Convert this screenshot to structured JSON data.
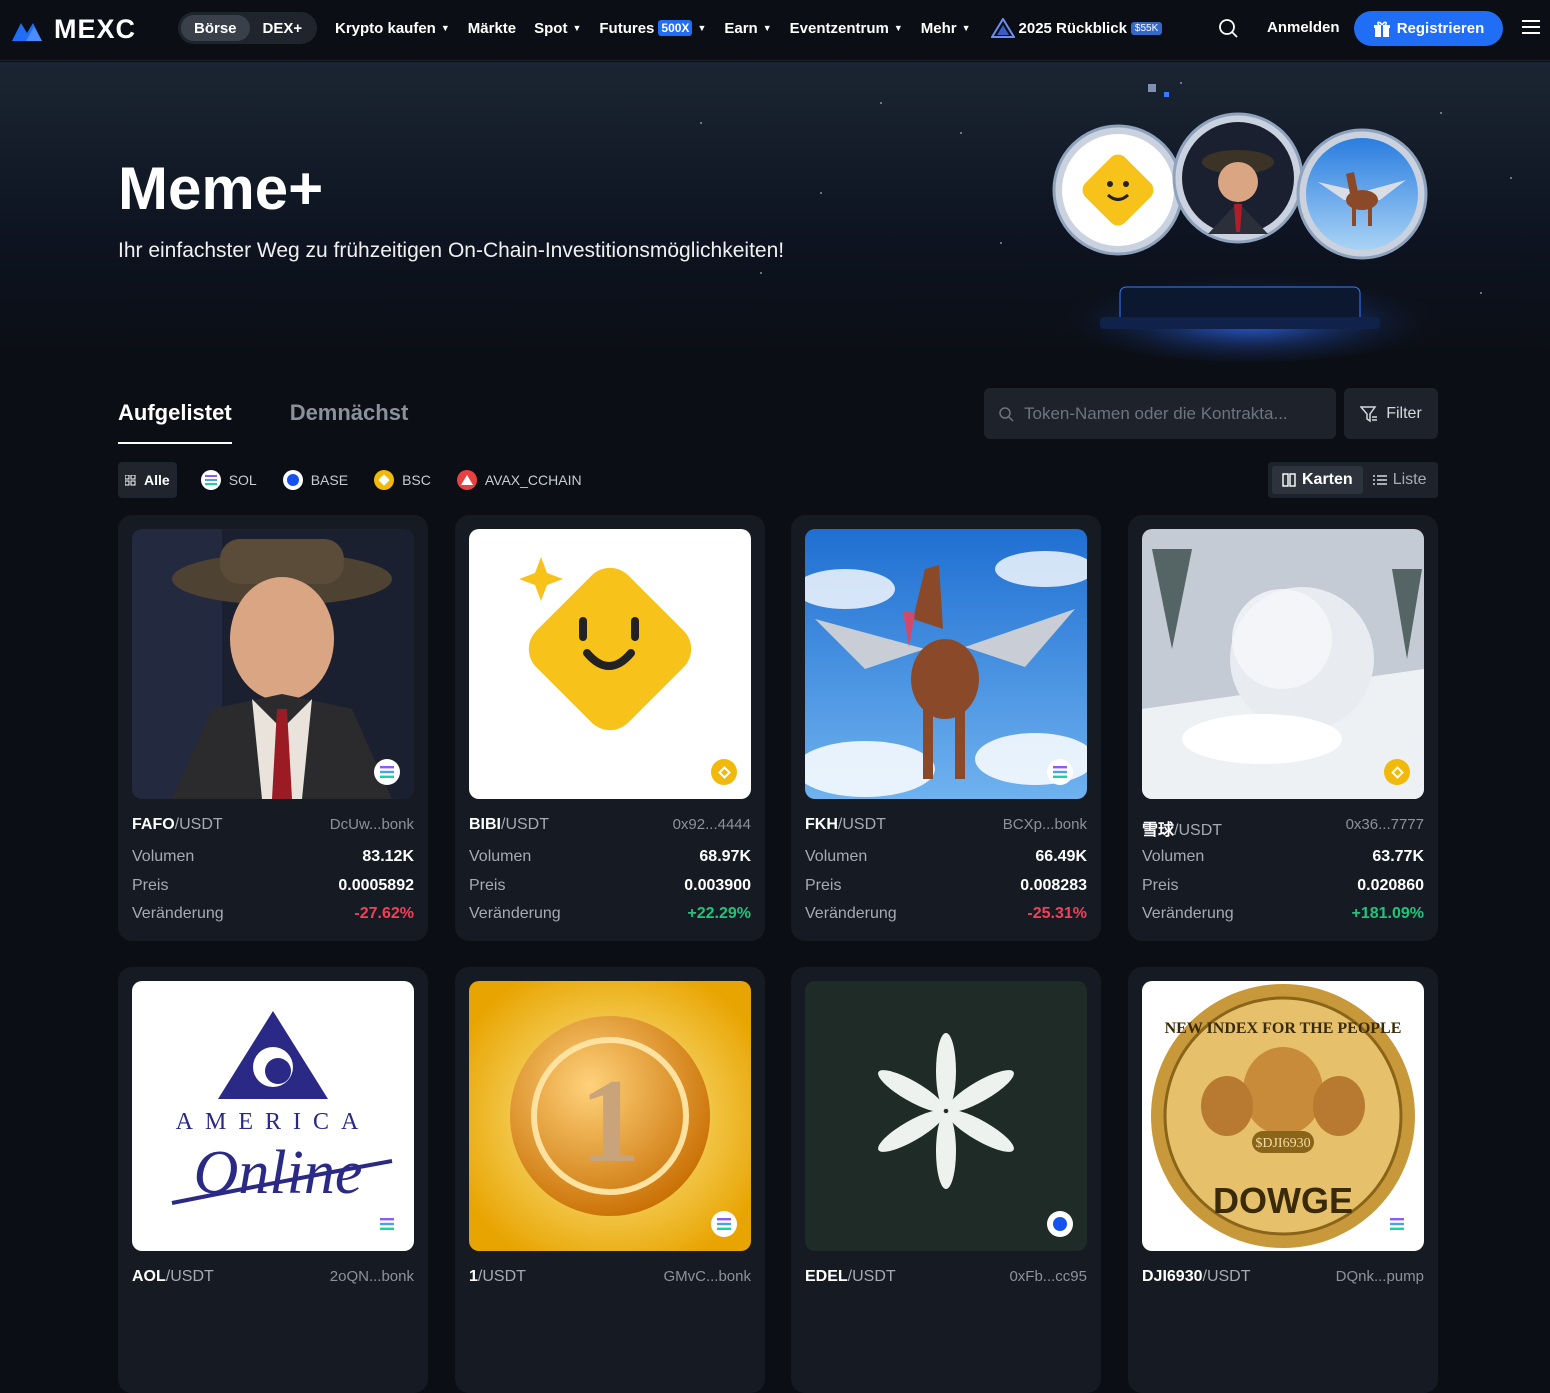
{
  "nav": {
    "brand": "MEXC",
    "segment": [
      "Börse",
      "DEX+"
    ],
    "links": [
      {
        "label": "Krypto kaufen",
        "caret": true
      },
      {
        "label": "Märkte",
        "caret": false
      },
      {
        "label": "Spot",
        "caret": true
      },
      {
        "label": "Futures",
        "badge": "500X",
        "caret": true
      },
      {
        "label": "Earn",
        "caret": true
      },
      {
        "label": "Eventzentrum",
        "caret": true
      },
      {
        "label": "Mehr",
        "caret": true
      },
      {
        "label": "2025 Rückblick",
        "badge": "$55K",
        "caret": false
      }
    ],
    "login": "Anmelden",
    "register": "Registrieren"
  },
  "hero": {
    "title": "Meme+",
    "subtitle": "Ihr einfachster Weg zu frühzeitigen On-Chain-Investitionsmöglichkeiten!"
  },
  "tabs": [
    "Aufgelistet",
    "Demnächst"
  ],
  "search": {
    "placeholder": "Token-Namen oder die Kontrakta..."
  },
  "filter_label": "Filter",
  "chains": [
    "Alle",
    "SOL",
    "BASE",
    "BSC",
    "AVAX_CCHAIN"
  ],
  "view": {
    "cards": "Karten",
    "list": "Liste"
  },
  "labels": {
    "volume": "Volumen",
    "price": "Preis",
    "change": "Veränderung"
  },
  "tokens": [
    {
      "symbol": "FAFO",
      "quote": "/USDT",
      "address": "DcUw...bonk",
      "volume": "83.12K",
      "price": "0.0005892",
      "change": "-27.62%",
      "chain": "SOL"
    },
    {
      "symbol": "BIBI",
      "quote": "/USDT",
      "address": "0x92...4444",
      "volume": "68.97K",
      "price": "0.003900",
      "change": "+22.29%",
      "chain": "BSC"
    },
    {
      "symbol": "FKH",
      "quote": "/USDT",
      "address": "BCXp...bonk",
      "volume": "66.49K",
      "price": "0.008283",
      "change": "-25.31%",
      "chain": "SOL"
    },
    {
      "symbol": "雪球",
      "quote": "/USDT",
      "address": "0x36...7777",
      "volume": "63.77K",
      "price": "0.020860",
      "change": "+181.09%",
      "chain": "BSC"
    },
    {
      "symbol": "AOL",
      "quote": "/USDT",
      "address": "2oQN...bonk",
      "chain": "SOL",
      "logo_text": [
        "AMERICA",
        "Online"
      ]
    },
    {
      "symbol": "1",
      "quote": "/USDT",
      "address": "GMvC...bonk",
      "chain": "SOL",
      "logo_text": [
        "1"
      ]
    },
    {
      "symbol": "EDEL",
      "quote": "/USDT",
      "address": "0xFb...cc95",
      "chain": "BASE"
    },
    {
      "symbol": "DJI6930",
      "quote": "/USDT",
      "address": "DQnk...pump",
      "chain": "SOL",
      "logo_text": [
        "NEW INDEX FOR THE PEOPLE",
        "$DJI6930",
        "DOWGE"
      ]
    }
  ],
  "colors": {
    "accent": "#1f6ef5",
    "negative": "#f0405a",
    "positive": "#20c47a",
    "card": "#161b23",
    "bg": "#0b0e14"
  }
}
